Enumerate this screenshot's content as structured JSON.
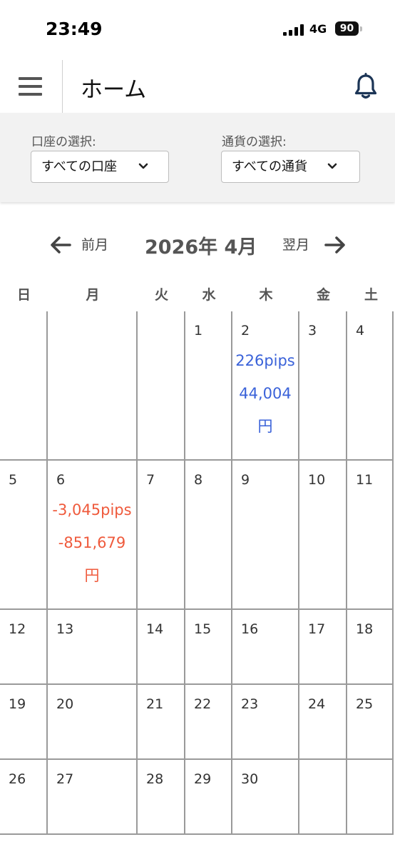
{
  "status_bar": {
    "time": "23:49",
    "network": "4G",
    "battery": "90"
  },
  "header": {
    "title": "ホーム"
  },
  "filters": {
    "account_label": "口座の選択:",
    "account_value": "すべての口座",
    "currency_label": "通貨の選択:",
    "currency_value": "すべての通貨"
  },
  "month_nav": {
    "prev_label": "前月",
    "title": "2026年 4月",
    "next_label": "翌月"
  },
  "calendar": {
    "weekdays": [
      "日",
      "月",
      "火",
      "水",
      "木",
      "金",
      "土"
    ],
    "weeks": [
      [
        {
          "day": ""
        },
        {
          "day": ""
        },
        {
          "day": ""
        },
        {
          "day": "1"
        },
        {
          "day": "2",
          "pips": "226pips",
          "yen": "44,004",
          "yen_unit": "円",
          "result": "profit"
        },
        {
          "day": "3"
        },
        {
          "day": "4"
        }
      ],
      [
        {
          "day": "5"
        },
        {
          "day": "6",
          "pips": "-3,045pips",
          "yen": "-851,679",
          "yen_unit": "円",
          "result": "loss"
        },
        {
          "day": "7"
        },
        {
          "day": "8"
        },
        {
          "day": "9"
        },
        {
          "day": "10"
        },
        {
          "day": "11"
        }
      ],
      [
        {
          "day": "12"
        },
        {
          "day": "13"
        },
        {
          "day": "14"
        },
        {
          "day": "15"
        },
        {
          "day": "16"
        },
        {
          "day": "17"
        },
        {
          "day": "18"
        }
      ],
      [
        {
          "day": "19"
        },
        {
          "day": "20"
        },
        {
          "day": "21"
        },
        {
          "day": "22"
        },
        {
          "day": "23"
        },
        {
          "day": "24"
        },
        {
          "day": "25"
        }
      ],
      [
        {
          "day": "26"
        },
        {
          "day": "27"
        },
        {
          "day": "28"
        },
        {
          "day": "29"
        },
        {
          "day": "30"
        },
        {
          "day": ""
        },
        {
          "day": ""
        }
      ]
    ]
  },
  "colors": {
    "profit": "#3a62d9",
    "loss": "#ef5a3c",
    "grid": "#9a9a9a"
  }
}
